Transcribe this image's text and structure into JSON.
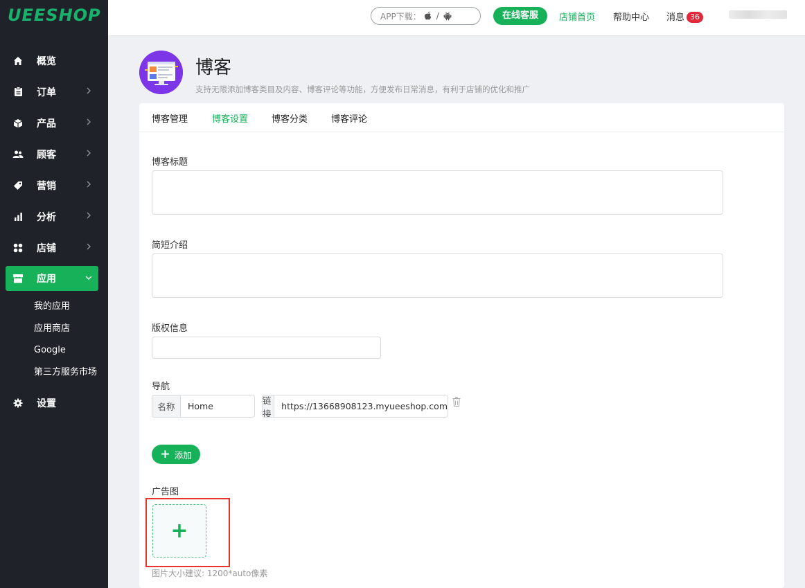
{
  "brand": {
    "logo_text": "UEESHOP",
    "accent": "#17b15a",
    "sidebar_bg": "#1f2229",
    "badge_color": "#e2293a"
  },
  "sidebar": {
    "items": [
      {
        "label": "概览",
        "icon": "home-icon",
        "has_arrow": false
      },
      {
        "label": "订单",
        "icon": "clipboard-icon",
        "has_arrow": true
      },
      {
        "label": "产品",
        "icon": "cube-icon",
        "has_arrow": true
      },
      {
        "label": "顾客",
        "icon": "users-icon",
        "has_arrow": true
      },
      {
        "label": "营销",
        "icon": "tag-icon",
        "has_arrow": true
      },
      {
        "label": "分析",
        "icon": "bar-chart-icon",
        "has_arrow": true
      },
      {
        "label": "店铺",
        "icon": "grid-icon",
        "has_arrow": true
      },
      {
        "label": "应用",
        "icon": "store-icon",
        "has_arrow": true,
        "active": true
      }
    ],
    "sub_items": [
      "我的应用",
      "应用商店",
      "Google",
      "第三方服务市场"
    ],
    "settings_label": "设置"
  },
  "topbar": {
    "app_download": "APP下载：",
    "app_sep": "/",
    "online_service": "在线客服",
    "store_home": "店铺首页",
    "help_center": "帮助中心",
    "messages": "消息",
    "message_count": "36"
  },
  "page": {
    "title": "博客",
    "description": "支持无限添加博客类目及内容、博客评论等功能，方便发布日常消息，有利于店铺的优化和推广"
  },
  "tabs": [
    "博客管理",
    "博客设置",
    "博客分类",
    "博客评论"
  ],
  "active_tab": "博客设置",
  "form": {
    "blog_title_label": "博客标题",
    "blog_title_value": "",
    "intro_label": "简短介绍",
    "intro_value": "",
    "copyright_label": "版权信息",
    "copyright_value": "",
    "nav_label": "导航",
    "nav_name_addon": "名称",
    "nav_name_value": "Home",
    "nav_link_addon": "链接",
    "nav_link_value": "https://13668908123.myueeshop.com",
    "add_button": "添加",
    "banner_label": "广告图",
    "banner_hint": "图片大小建议: 1200*auto像素"
  }
}
